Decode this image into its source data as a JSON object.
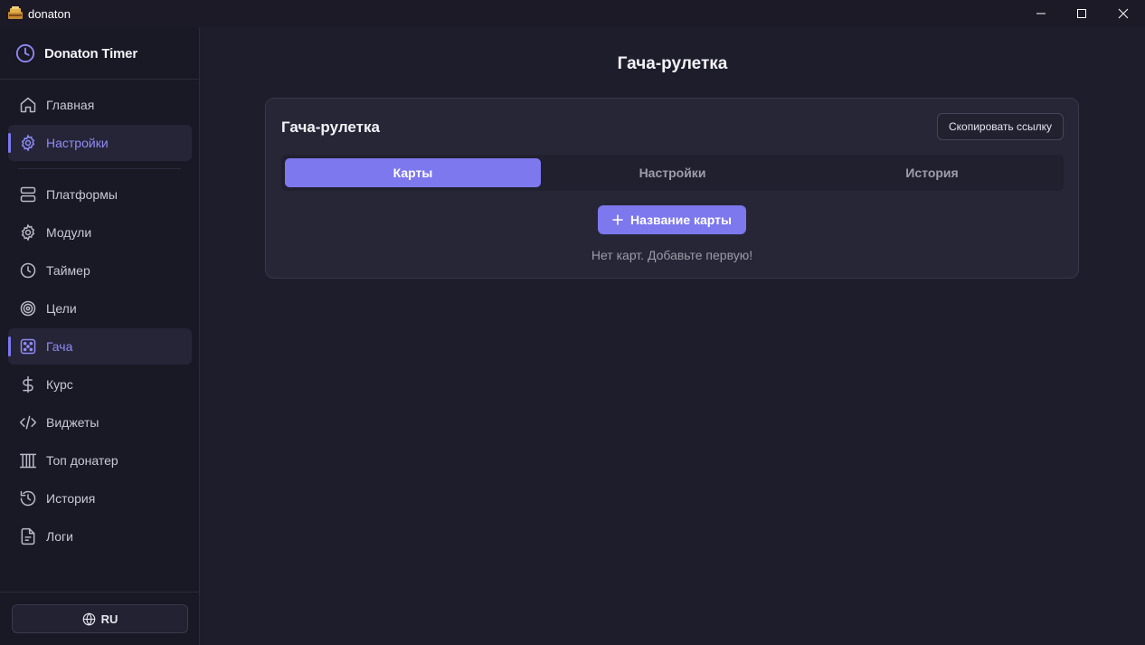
{
  "window": {
    "title": "donaton",
    "controls": [
      "minimize-icon",
      "maximize-icon",
      "close-icon"
    ]
  },
  "brand": {
    "name": "Donaton Timer",
    "icon": "clock-icon"
  },
  "sidebar": {
    "items": [
      {
        "label": "Главная",
        "icon": "home-icon",
        "active": false
      },
      {
        "label": "Настройки",
        "icon": "gear-icon",
        "active": true
      },
      {
        "label": "Платформы",
        "icon": "server-icon",
        "active": false
      },
      {
        "label": "Модули",
        "icon": "gear-icon",
        "active": false
      },
      {
        "label": "Таймер",
        "icon": "clock-icon",
        "active": false
      },
      {
        "label": "Цели",
        "icon": "target-icon",
        "active": false
      },
      {
        "label": "Гача",
        "icon": "dice-icon",
        "active": true
      },
      {
        "label": "Курс",
        "icon": "dollar-icon",
        "active": false
      },
      {
        "label": "Виджеты",
        "icon": "code-icon",
        "active": false
      },
      {
        "label": "Топ донатер",
        "icon": "podium-icon",
        "active": false
      },
      {
        "label": "История",
        "icon": "history-icon",
        "active": false
      },
      {
        "label": "Логи",
        "icon": "file-text-icon",
        "active": false
      }
    ],
    "language": {
      "label": "RU",
      "icon": "globe-icon"
    }
  },
  "main": {
    "page_title": "Гача-рулетка",
    "card": {
      "title": "Гача-рулетка",
      "copy_link_label": "Скопировать ссылку",
      "tabs": [
        {
          "label": "Карты",
          "active": true
        },
        {
          "label": "Настройки",
          "active": false
        },
        {
          "label": "История",
          "active": false
        }
      ],
      "add_button_label": "Название карты",
      "empty_text": "Нет карт. Добавьте первую!"
    }
  },
  "colors": {
    "accent": "#7d78ee",
    "background": "#1e1d2b",
    "sidebar": "#191825",
    "card": "#272637"
  }
}
